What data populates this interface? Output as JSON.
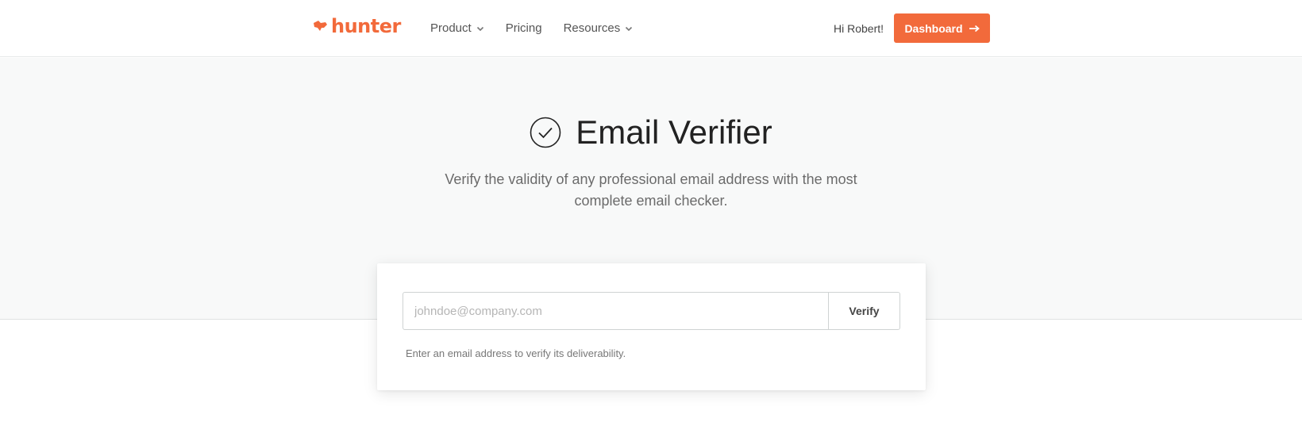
{
  "nav": {
    "brand": "hunter",
    "links": [
      {
        "label": "Product",
        "has_dropdown": true
      },
      {
        "label": "Pricing",
        "has_dropdown": false
      },
      {
        "label": "Resources",
        "has_dropdown": true
      }
    ],
    "greeting": "Hi Robert!",
    "dashboard_label": "Dashboard"
  },
  "hero": {
    "title": "Email Verifier",
    "subtitle": "Verify the validity of any professional email address with the most complete email checker."
  },
  "verifier": {
    "placeholder": "johndoe@company.com",
    "value": "",
    "button_label": "Verify",
    "helper_text": "Enter an email address to verify its deliverability."
  },
  "colors": {
    "brand": "#f26a3b",
    "hero_bg": "#f8f9f9"
  },
  "icons": {
    "logo": "fox-icon",
    "title": "check-circle-icon",
    "dropdown": "chevron-down-icon",
    "dashboard": "arrow-right-icon"
  }
}
